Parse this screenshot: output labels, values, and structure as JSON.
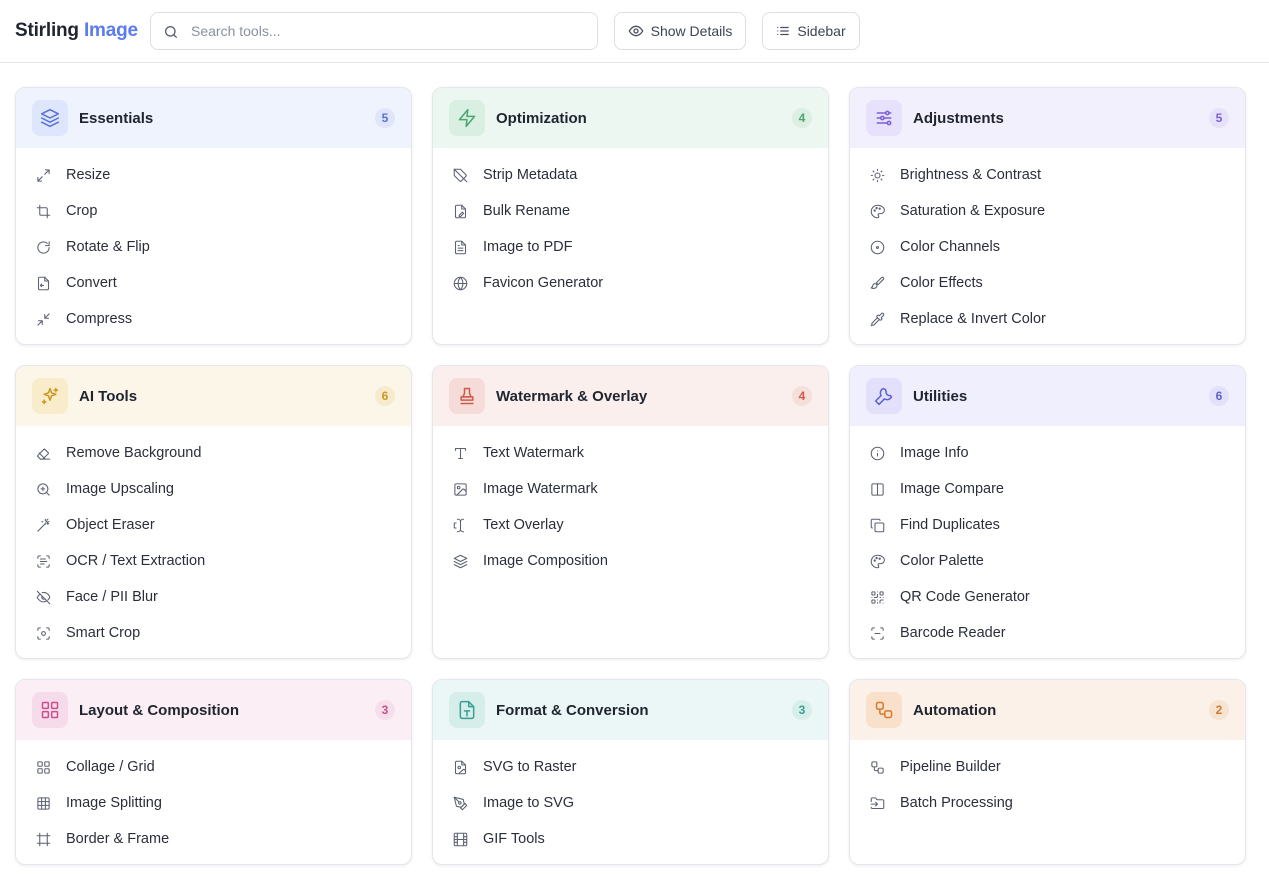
{
  "brand": {
    "part1": "Stirling",
    "part2": "Image"
  },
  "search": {
    "placeholder": "Search tools..."
  },
  "header_buttons": {
    "details": "Show Details",
    "sidebar": "Sidebar"
  },
  "colors": {
    "brand_accent": "#5a7cf0",
    "essentials": "#5a72d8",
    "optimization": "#4ba56f",
    "adjustments": "#7b5fd8",
    "ai_tools": "#cc9622",
    "watermark": "#d0584b",
    "utilities": "#6060d0",
    "layout": "#cc4f8d",
    "format": "#3b9e92",
    "automation": "#d47a2e"
  },
  "categories": [
    {
      "title": "Essentials",
      "count": "5",
      "icon": "layers-icon",
      "items": [
        {
          "label": "Resize",
          "icon": "resize-icon"
        },
        {
          "label": "Crop",
          "icon": "crop-icon"
        },
        {
          "label": "Rotate & Flip",
          "icon": "rotate-icon"
        },
        {
          "label": "Convert",
          "icon": "convert-icon"
        },
        {
          "label": "Compress",
          "icon": "compress-icon"
        }
      ]
    },
    {
      "title": "Optimization",
      "count": "4",
      "icon": "lightning-icon",
      "items": [
        {
          "label": "Strip Metadata",
          "icon": "tag-off-icon"
        },
        {
          "label": "Bulk Rename",
          "icon": "file-edit-icon"
        },
        {
          "label": "Image to PDF",
          "icon": "file-text-icon"
        },
        {
          "label": "Favicon Generator",
          "icon": "globe-icon"
        }
      ]
    },
    {
      "title": "Adjustments",
      "count": "5",
      "icon": "sliders-icon",
      "items": [
        {
          "label": "Brightness & Contrast",
          "icon": "sun-icon"
        },
        {
          "label": "Saturation & Exposure",
          "icon": "palette-icon"
        },
        {
          "label": "Color Channels",
          "icon": "target-icon"
        },
        {
          "label": "Color Effects",
          "icon": "paintbrush-icon"
        },
        {
          "label": "Replace & Invert Color",
          "icon": "pipette-icon"
        }
      ]
    },
    {
      "title": "AI Tools",
      "count": "6",
      "icon": "sparkles-icon",
      "items": [
        {
          "label": "Remove Background",
          "icon": "eraser-icon"
        },
        {
          "label": "Image Upscaling",
          "icon": "zoom-in-icon"
        },
        {
          "label": "Object Eraser",
          "icon": "magic-wand-icon"
        },
        {
          "label": "OCR / Text Extraction",
          "icon": "scan-text-icon"
        },
        {
          "label": "Face / PII Blur",
          "icon": "eye-off-icon"
        },
        {
          "label": "Smart Crop",
          "icon": "focus-icon"
        }
      ]
    },
    {
      "title": "Watermark & Overlay",
      "count": "4",
      "icon": "stamp-icon",
      "items": [
        {
          "label": "Text Watermark",
          "icon": "type-icon"
        },
        {
          "label": "Image Watermark",
          "icon": "image-icon"
        },
        {
          "label": "Text Overlay",
          "icon": "text-cursor-icon"
        },
        {
          "label": "Image Composition",
          "icon": "layers-icon"
        }
      ]
    },
    {
      "title": "Utilities",
      "count": "6",
      "icon": "wrench-icon",
      "items": [
        {
          "label": "Image Info",
          "icon": "info-icon"
        },
        {
          "label": "Image Compare",
          "icon": "columns-icon"
        },
        {
          "label": "Find Duplicates",
          "icon": "copy-icon"
        },
        {
          "label": "Color Palette",
          "icon": "palette-icon"
        },
        {
          "label": "QR Code Generator",
          "icon": "qr-code-icon"
        },
        {
          "label": "Barcode Reader",
          "icon": "scan-barcode-icon"
        }
      ]
    },
    {
      "title": "Layout & Composition",
      "count": "3",
      "icon": "grid-icon",
      "items": [
        {
          "label": "Collage / Grid",
          "icon": "grid-icon"
        },
        {
          "label": "Image Splitting",
          "icon": "table-grid-icon"
        },
        {
          "label": "Border & Frame",
          "icon": "frame-icon"
        }
      ]
    },
    {
      "title": "Format & Conversion",
      "count": "3",
      "icon": "file-type-icon",
      "items": [
        {
          "label": "SVG to Raster",
          "icon": "file-image-icon"
        },
        {
          "label": "Image to SVG",
          "icon": "pen-tool-icon"
        },
        {
          "label": "GIF Tools",
          "icon": "film-icon"
        }
      ]
    },
    {
      "title": "Automation",
      "count": "2",
      "icon": "workflow-icon",
      "items": [
        {
          "label": "Pipeline Builder",
          "icon": "workflow-icon"
        },
        {
          "label": "Batch Processing",
          "icon": "folder-input-icon"
        }
      ]
    }
  ]
}
